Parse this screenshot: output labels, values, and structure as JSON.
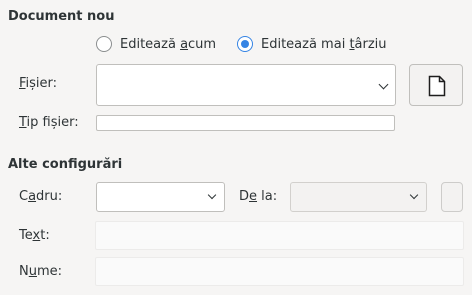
{
  "document_section": {
    "title": "Document nou",
    "radio_now": {
      "label_pre": "Editează ",
      "label_u": "a",
      "label_post": "cum",
      "checked": false
    },
    "radio_later": {
      "label_pre": "Editează mai ",
      "label_u": "t",
      "label_post": "ârziu",
      "checked": true
    },
    "file_label_u": "F",
    "file_label_rest": "ișier:",
    "file_value": "",
    "file_type_label_u": "T",
    "file_type_label_rest": "ip fișier:",
    "file_type_value": ""
  },
  "other_section": {
    "title": "Alte configurări",
    "frame_label_pre": "C",
    "frame_label_u": "a",
    "frame_label_post": "dru:",
    "frame_value": "",
    "from_label_pre": "D",
    "from_label_u": "e",
    "from_label_post": " la:",
    "from_value": "",
    "text_label_pre": "Te",
    "text_label_u": "x",
    "text_label_post": "t:",
    "text_value": "",
    "name_label_pre": "N",
    "name_label_u": "u",
    "name_label_post": "me:",
    "name_value": ""
  },
  "icons": {
    "new_document": "new-document-icon"
  },
  "colors": {
    "accent": "#3584e4"
  }
}
